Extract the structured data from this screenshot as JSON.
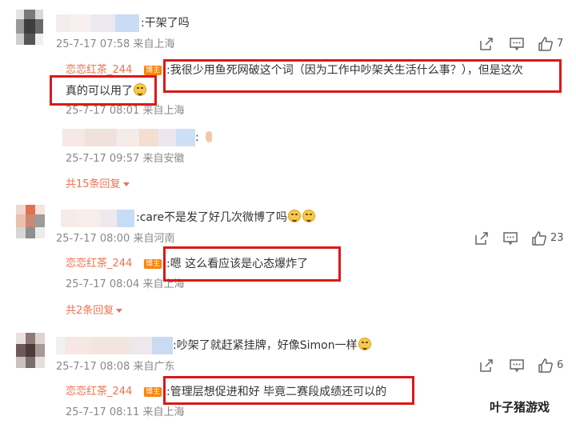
{
  "comments": [
    {
      "text": ":干架了吗",
      "meta": "25-7-17 07:58 来自上海",
      "likes": "7",
      "replies": [
        {
          "name": "恋恋红茶_244",
          "badge": "博主",
          "text": ":我很少用鱼死网破这个词（因为工作中吵架关生活什么事？），但是这次",
          "text2": "真的可以用了",
          "meta": "25-7-17 08:01 来自上海"
        },
        {
          "text": ":",
          "meta": "25-7-17 09:57 来自安徽"
        }
      ],
      "more": "共15条回复"
    },
    {
      "text": ":care不是发了好几次微博了吗",
      "meta": "25-7-17 08:00 来自河南",
      "likes": "23",
      "replies": [
        {
          "name": "恋恋红茶_244",
          "badge": "博主",
          "text": ":嗯 这么看应该是心态爆炸了",
          "meta": "25-7-17 08:04 来自上海"
        }
      ],
      "more": "共2条回复"
    },
    {
      "text": ":吵架了就赶紧挂牌，好像Simon一样",
      "meta": "25-7-17 08:08 来自广东",
      "likes": "6",
      "replies": [
        {
          "name": "恋恋红茶_244",
          "badge": "博主",
          "text": ":管理层想促进和好 毕竟二赛段成绩还可以的",
          "meta": "25-7-17 08:11 来自上海"
        }
      ]
    }
  ],
  "watermark": "叶子猪游戏",
  "colors": {
    "link": "#eb7350",
    "highlight": "#d91919",
    "meta": "#888888"
  },
  "icons": [
    "share-icon",
    "comment-icon",
    "thumbs-up-icon",
    "caret-down-icon",
    "emoji-icon"
  ]
}
